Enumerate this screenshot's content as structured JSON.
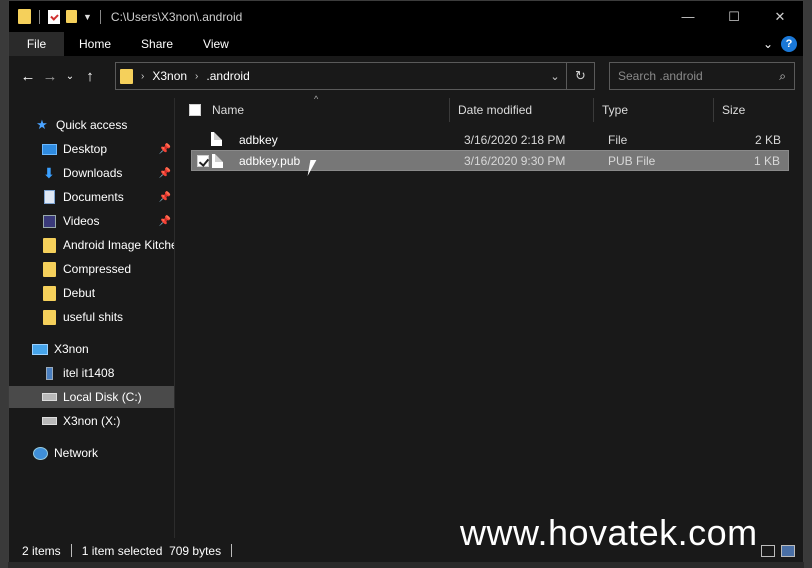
{
  "window": {
    "title_path": "C:\\Users\\X3non\\.android",
    "controls": {
      "minimize": "—",
      "maximize": "☐",
      "close": "✕"
    }
  },
  "ribbon": {
    "tabs": [
      {
        "label": "File"
      },
      {
        "label": "Home"
      },
      {
        "label": "Share"
      },
      {
        "label": "View"
      }
    ],
    "help_label": "?"
  },
  "address": {
    "crumbs": [
      "X3non",
      ".android"
    ],
    "search_placeholder": "Search .android"
  },
  "nav": {
    "quick_access": "Quick access",
    "items": [
      {
        "label": "Desktop",
        "icon": "desktop-icon",
        "pinned": true
      },
      {
        "label": "Downloads",
        "icon": "downloads-icon",
        "pinned": true
      },
      {
        "label": "Documents",
        "icon": "documents-icon",
        "pinned": true
      },
      {
        "label": "Videos",
        "icon": "videos-icon",
        "pinned": true
      },
      {
        "label": "Android Image Kitchen",
        "icon": "folder-icon",
        "pinned": false
      },
      {
        "label": "Compressed",
        "icon": "folder-icon",
        "pinned": false
      },
      {
        "label": "Debut",
        "icon": "folder-icon",
        "pinned": false
      },
      {
        "label": "useful shits",
        "icon": "folder-icon",
        "pinned": false
      }
    ],
    "this_pc": "X3non",
    "devices": [
      {
        "label": "itel it1408",
        "icon": "phone-icon"
      },
      {
        "label": "Local Disk (C:)",
        "icon": "disk-icon",
        "selected": true
      },
      {
        "label": "X3non (X:)",
        "icon": "disk-icon"
      }
    ],
    "network": "Network"
  },
  "columns": {
    "name": "Name",
    "date": "Date modified",
    "type": "Type",
    "size": "Size"
  },
  "files": [
    {
      "name": "adbkey",
      "date": "3/16/2020 2:18 PM",
      "type": "File",
      "size": "2 KB",
      "selected": false
    },
    {
      "name": "adbkey.pub",
      "date": "3/16/2020 9:30 PM",
      "type": "PUB File",
      "size": "1 KB",
      "selected": true
    }
  ],
  "status": {
    "item_count": "2 items",
    "selection": "1 item selected  709 bytes"
  },
  "watermark": "www.hovatek.com"
}
